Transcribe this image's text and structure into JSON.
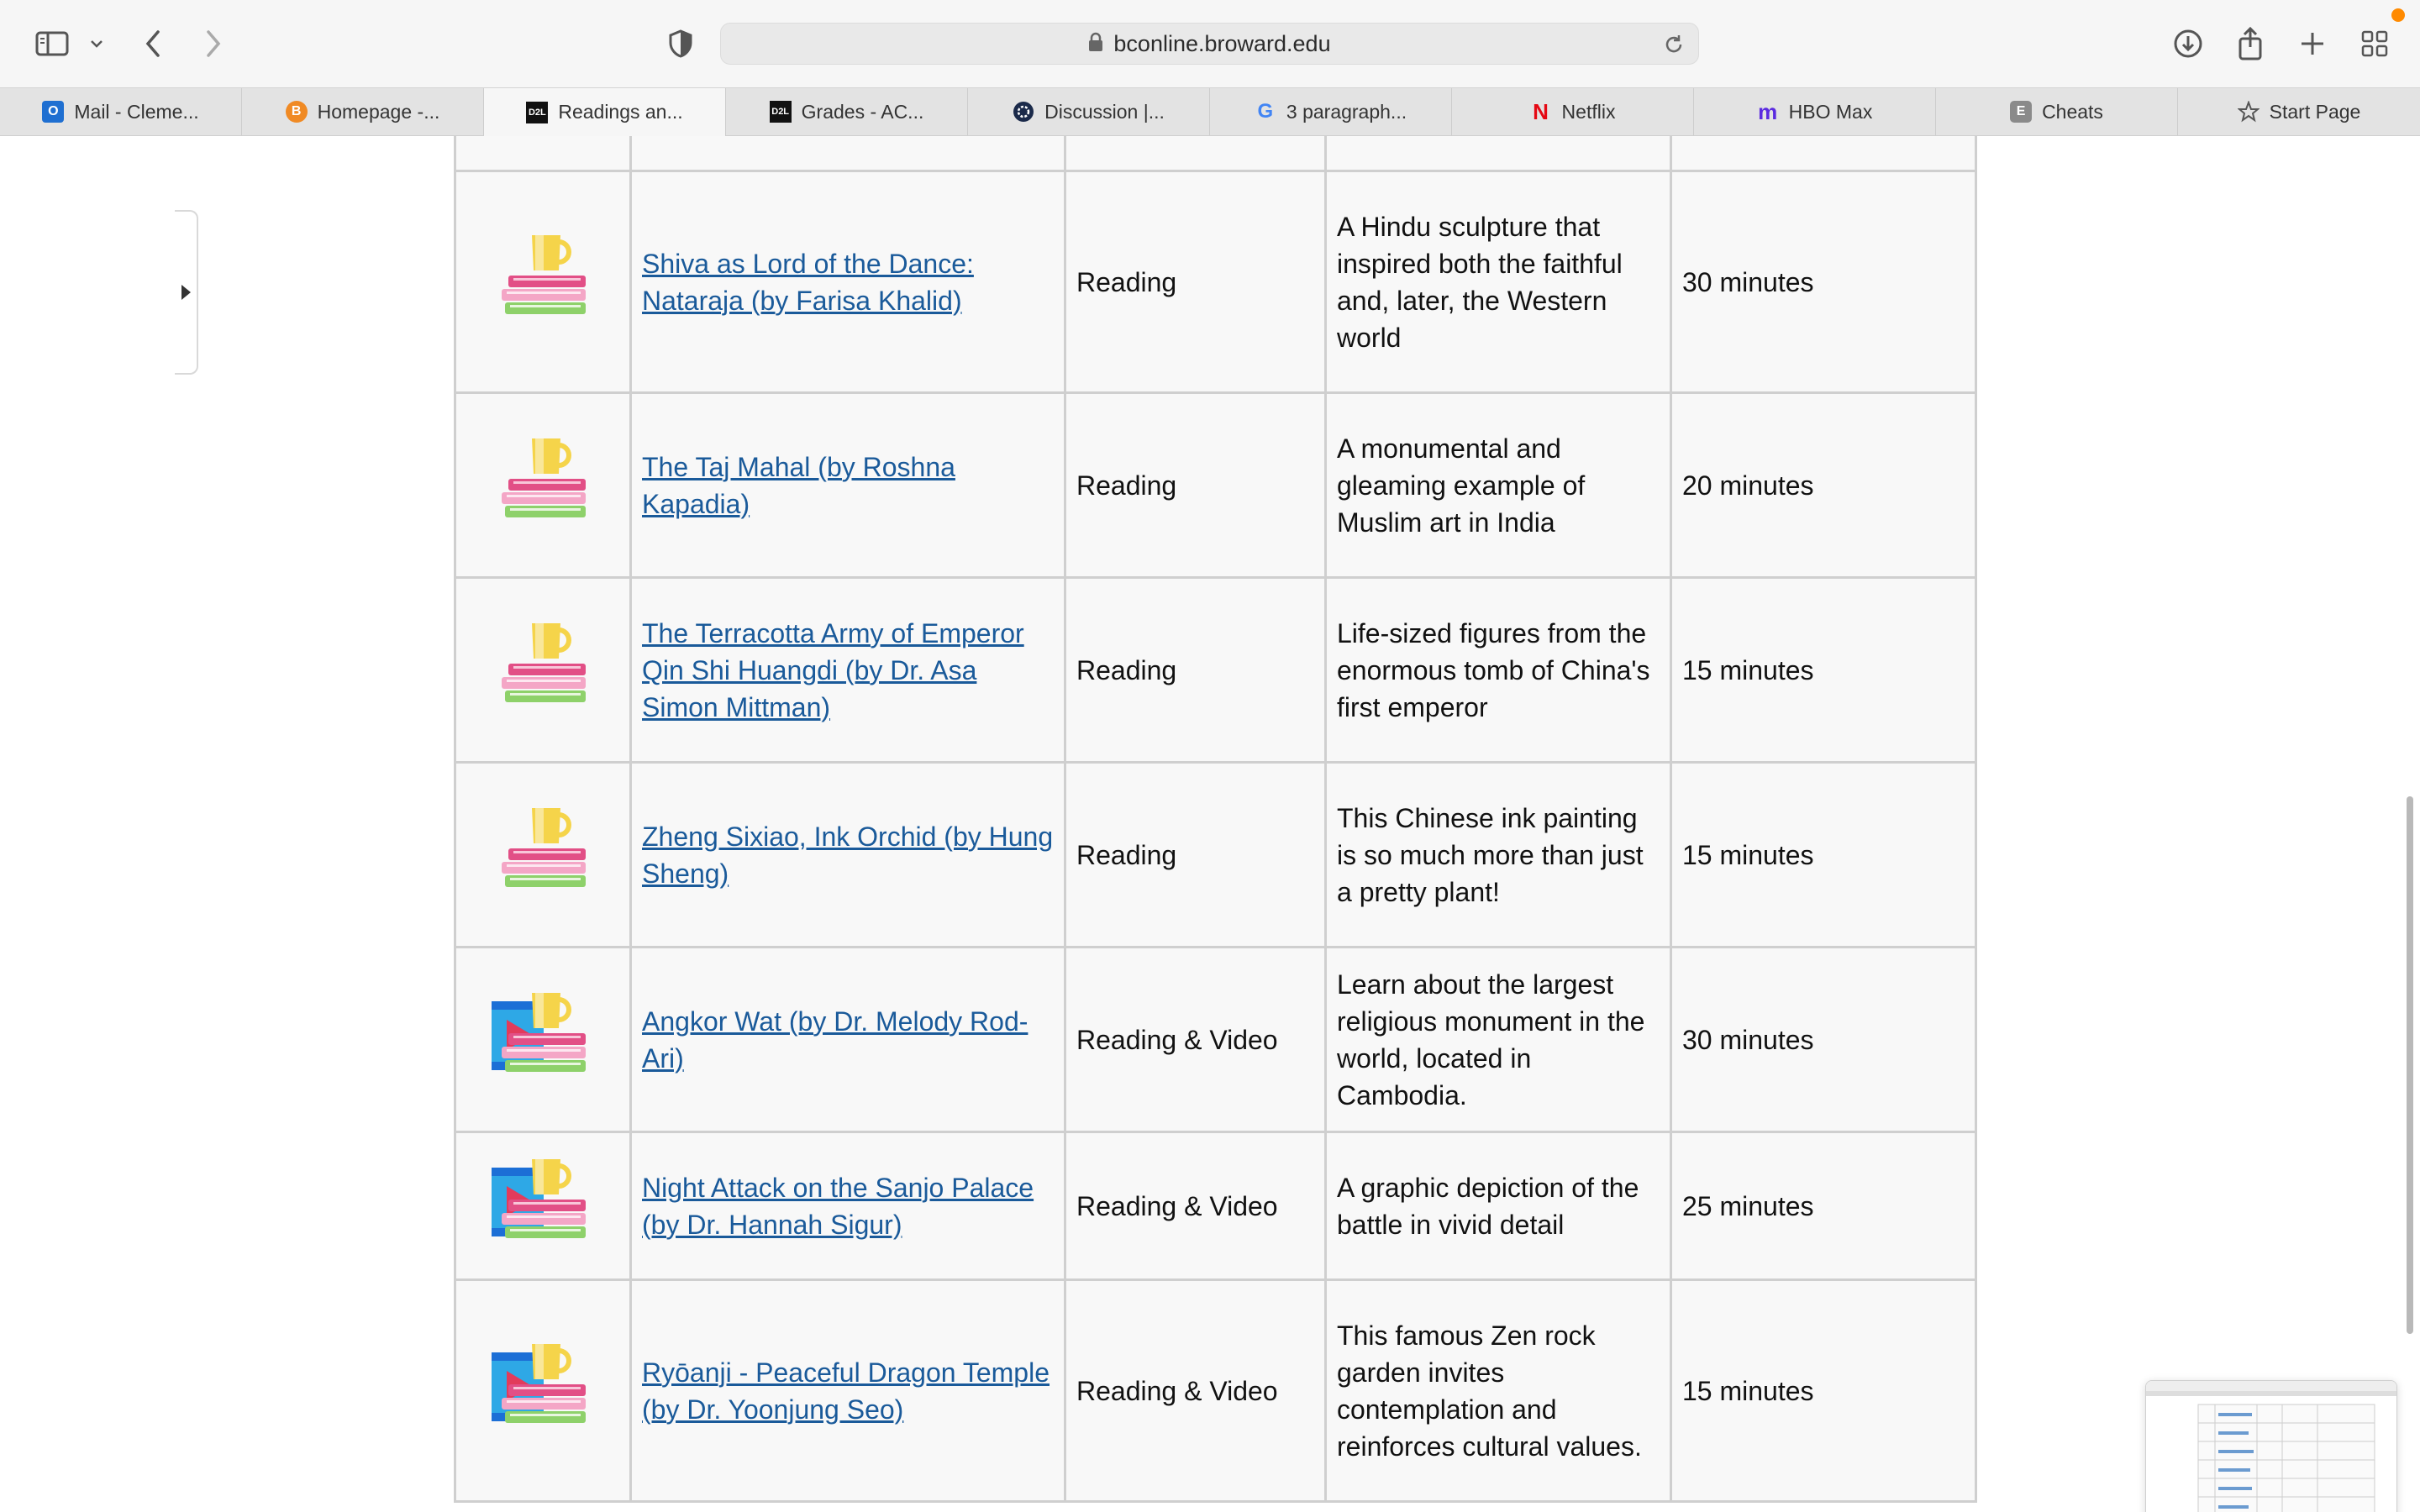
{
  "browser": {
    "url": "bconline.broward.edu",
    "tabs": [
      {
        "label": "Mail - Cleme...",
        "icon": "outlook-icon",
        "active": false
      },
      {
        "label": "Homepage -...",
        "icon": "brightspace-icon",
        "active": false
      },
      {
        "label": "Readings an...",
        "icon": "d2l-icon",
        "active": true
      },
      {
        "label": "Grades - AC...",
        "icon": "d2l-icon",
        "active": false
      },
      {
        "label": "Discussion |...",
        "icon": "discussion-icon",
        "active": false
      },
      {
        "label": "3 paragraph...",
        "icon": "google-icon",
        "active": false
      },
      {
        "label": "Netflix",
        "icon": "netflix-icon",
        "active": false
      },
      {
        "label": "HBO Max",
        "icon": "hbomax-icon",
        "active": false
      },
      {
        "label": "Cheats",
        "icon": "cheats-icon",
        "active": false
      },
      {
        "label": "Start Page",
        "icon": "star-icon",
        "active": false
      }
    ],
    "accent": "#ff8a00"
  },
  "readings": [
    {
      "icon": "reading-icon",
      "title": "Shiva as Lord of the Dance: Nataraja (by Farisa Khalid)",
      "type": "Reading",
      "description": "A Hindu sculpture that inspired both the faithful and, later, the Western world",
      "time": "30 minutes"
    },
    {
      "icon": "reading-icon",
      "title": "The Taj Mahal (by Roshna Kapadia)",
      "type": "Reading",
      "description": "A monumental and gleaming example of Muslim art in India",
      "time": "20 minutes"
    },
    {
      "icon": "reading-icon",
      "title": "The Terracotta Army of Emperor Qin Shi Huangdi (by Dr. Asa Simon Mittman)",
      "type": "Reading",
      "description": "Life-sized figures from the enormous tomb of China's first emperor",
      "time": "15 minutes"
    },
    {
      "icon": "reading-icon",
      "title": "Zheng Sixiao, Ink Orchid (by Hung Sheng)",
      "type": "Reading",
      "description": "This Chinese ink painting is so much more than just a pretty plant!",
      "time": "15 minutes"
    },
    {
      "icon": "reading-video-icon",
      "title": "Angkor Wat (by Dr. Melody Rod-Ari)",
      "type": "Reading & Video",
      "description": "Learn about the largest religious monument in the world, located in Cambodia.",
      "time": "30 minutes"
    },
    {
      "icon": "reading-video-icon",
      "title": "Night Attack on the Sanjo Palace (by Dr. Hannah Sigur)",
      "type": "Reading & Video",
      "description": "A graphic depiction of the battle in vivid detail",
      "time": "25 minutes"
    },
    {
      "icon": "reading-video-icon",
      "title": "Ryōanji - Peaceful Dragon Temple (by Dr. Yoonjung Seo)",
      "type": "Reading & Video",
      "description": "This famous Zen rock garden invites contemplation and reinforces cultural values.",
      "time": "15 minutes"
    }
  ]
}
